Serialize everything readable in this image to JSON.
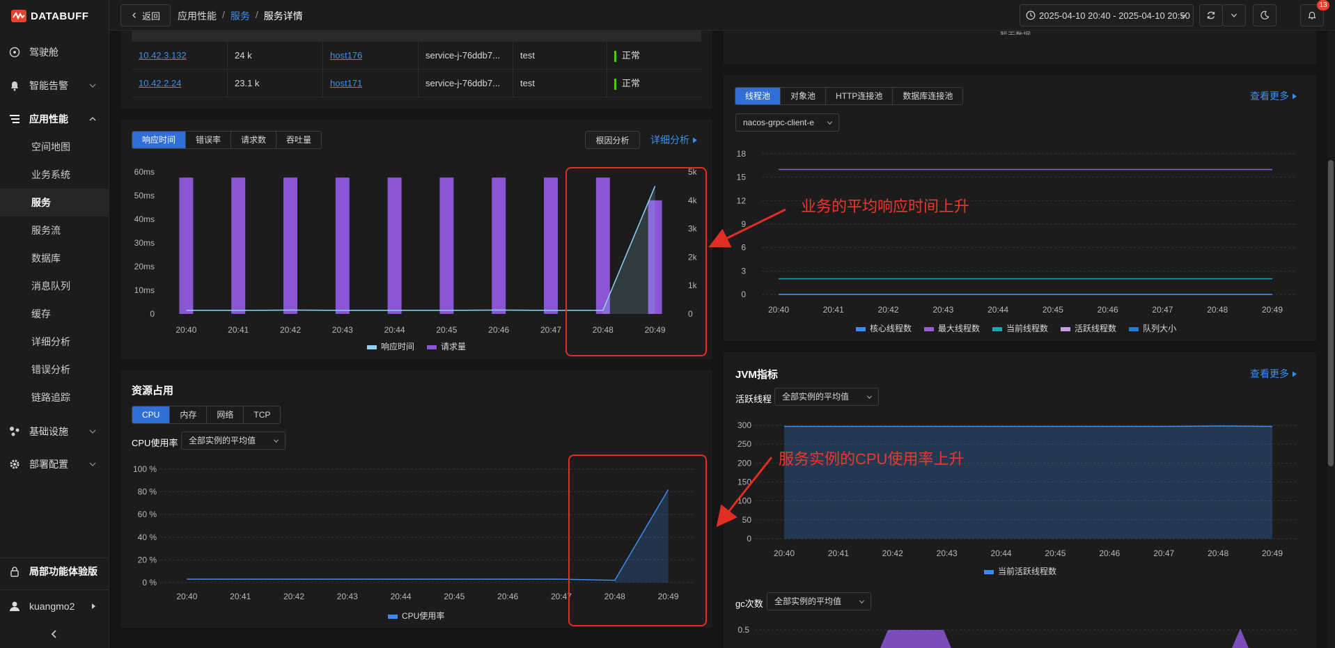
{
  "app": {
    "logo_text": "DATABUFF",
    "notification_count": "13"
  },
  "sidebar": {
    "items": [
      {
        "label": "驾驶舱",
        "icon": "dashboard-icon"
      },
      {
        "label": "智能告警",
        "icon": "bell-icon"
      },
      {
        "label": "应用性能",
        "icon": "apm-icon"
      },
      {
        "label": "基础设施",
        "icon": "infra-icon"
      },
      {
        "label": "部署配置",
        "icon": "gear-icon"
      }
    ],
    "sub_items": [
      "空间地图",
      "业务系统",
      "服务",
      "服务流",
      "数据库",
      "消息队列",
      "缓存",
      "详细分析",
      "错误分析",
      "链路追踪"
    ],
    "active_sub": "服务",
    "trial_label": "局部功能体验版",
    "user_name": "kuangmo2"
  },
  "topbar": {
    "back_label": "返回",
    "breadcrumb": [
      "应用性能",
      "服务",
      "服务详情"
    ],
    "time_range": "2025-04-10 20:40 - 2025-04-10 20:50"
  },
  "instances_table": {
    "rows": [
      {
        "ip": "10.42.3.132",
        "count": "24 k",
        "host": "host176",
        "pod": "service-j-76ddb7...",
        "env": "test",
        "status": "正常"
      },
      {
        "ip": "10.42.2.24",
        "count": "23.1 k",
        "host": "host171",
        "pod": "service-j-76ddb7...",
        "env": "test",
        "status": "正常"
      }
    ]
  },
  "perf_panel": {
    "tabs": [
      "响应时间",
      "错误率",
      "请求数",
      "吞吐量"
    ],
    "active_tab": "响应时间",
    "root_cause_button": "根因分析",
    "detail_link": "详细分析"
  },
  "resource_panel": {
    "title": "资源占用",
    "tabs": [
      "CPU",
      "内存",
      "网络",
      "TCP"
    ],
    "active_tab": "CPU",
    "metric_label": "CPU使用率",
    "select_value": "全部实例的平均值"
  },
  "pool_panel": {
    "tabs": [
      "线程池",
      "对象池",
      "HTTP连接池",
      "数据库连接池"
    ],
    "active_tab": "线程池",
    "more_link": "查看更多",
    "select_value": "nacos-grpc-client-e",
    "top_partial_text": "暂无数据"
  },
  "jvm_panel": {
    "title": "JVM指标",
    "more_link": "查看更多",
    "active_label": "活跃线程",
    "active_select": "全部实例的平均值",
    "gc_label": "gc次数",
    "gc_select": "全部实例的平均值"
  },
  "annotations": {
    "response_time": "业务的平均响应时间上升",
    "cpu": "服务实例的CPU使用率上升"
  },
  "chart_data": [
    {
      "type": "bar",
      "categories": [
        "20:40",
        "20:41",
        "20:42",
        "20:43",
        "20:44",
        "20:45",
        "20:46",
        "20:47",
        "20:48",
        "20:49"
      ],
      "series": [
        {
          "name": "响应时间",
          "type": "line",
          "axis": "left",
          "color": "#8fd3f4",
          "values": [
            1.5,
            1.5,
            1.6,
            1.5,
            1.5,
            1.5,
            1.6,
            1.5,
            1.5,
            54
          ]
        },
        {
          "name": "请求量",
          "type": "bar",
          "axis": "right",
          "color": "#8b56d6",
          "values": [
            4.8,
            4.8,
            4.8,
            4.8,
            4.8,
            4.8,
            4.8,
            4.8,
            4.8,
            4.0
          ]
        }
      ],
      "y_left_ticks": [
        "60ms",
        "50ms",
        "40ms",
        "30ms",
        "20ms",
        "10ms",
        "0"
      ],
      "y_right_ticks": [
        "5k",
        "4k",
        "3k",
        "2k",
        "1k",
        "0"
      ],
      "ylim_left": [
        0,
        60
      ],
      "ylim_right": [
        0,
        5
      ]
    },
    {
      "type": "area",
      "categories": [
        "20:40",
        "20:41",
        "20:42",
        "20:43",
        "20:44",
        "20:45",
        "20:46",
        "20:47",
        "20:48",
        "20:49"
      ],
      "series": [
        {
          "name": "CPU使用率",
          "color": "#3b8ef0",
          "values": [
            3,
            3,
            3,
            3,
            3,
            3,
            3,
            3,
            2,
            82
          ]
        }
      ],
      "y_ticks": [
        "100 %",
        "80 %",
        "60 %",
        "40 %",
        "20 %",
        "0 %"
      ],
      "ylim": [
        0,
        100
      ]
    },
    {
      "type": "line",
      "categories": [
        "20:40",
        "20:41",
        "20:42",
        "20:43",
        "20:44",
        "20:45",
        "20:46",
        "20:47",
        "20:48",
        "20:49"
      ],
      "series": [
        {
          "name": "核心线程数",
          "color": "#3b8ef0",
          "values": [
            0,
            0,
            0,
            0,
            0,
            0,
            0,
            0,
            0,
            0
          ]
        },
        {
          "name": "最大线程数",
          "color": "#9b5cd6",
          "values": [
            16,
            16,
            16,
            16,
            16,
            16,
            16,
            16,
            16,
            16
          ]
        },
        {
          "name": "当前线程数",
          "color": "#1fa3b5",
          "values": [
            2,
            2,
            2,
            2,
            2,
            2,
            2,
            2,
            2,
            2
          ]
        },
        {
          "name": "活跃线程数",
          "color": "#c79de8",
          "values": [
            0,
            0,
            0,
            0,
            0,
            0,
            0,
            0,
            0,
            0
          ]
        },
        {
          "name": "队列大小",
          "color": "#1f7fd6",
          "values": [
            0,
            0,
            0,
            0,
            0,
            0,
            0,
            0,
            0,
            0
          ]
        }
      ],
      "y_ticks": [
        "18",
        "15",
        "12",
        "9",
        "6",
        "3",
        "0"
      ],
      "ylim": [
        0,
        18
      ]
    },
    {
      "type": "area",
      "categories": [
        "20:40",
        "20:41",
        "20:42",
        "20:43",
        "20:44",
        "20:45",
        "20:46",
        "20:47",
        "20:48",
        "20:49"
      ],
      "series": [
        {
          "name": "当前活跃线程数",
          "color": "#3b8ef0",
          "values": [
            297,
            297,
            297,
            297,
            297,
            297,
            297,
            297,
            298,
            297
          ]
        }
      ],
      "y_ticks": [
        "300",
        "250",
        "200",
        "150",
        "100",
        "50",
        "0"
      ],
      "ylim": [
        0,
        300
      ]
    }
  ],
  "gc_axis_tick": "0.5"
}
